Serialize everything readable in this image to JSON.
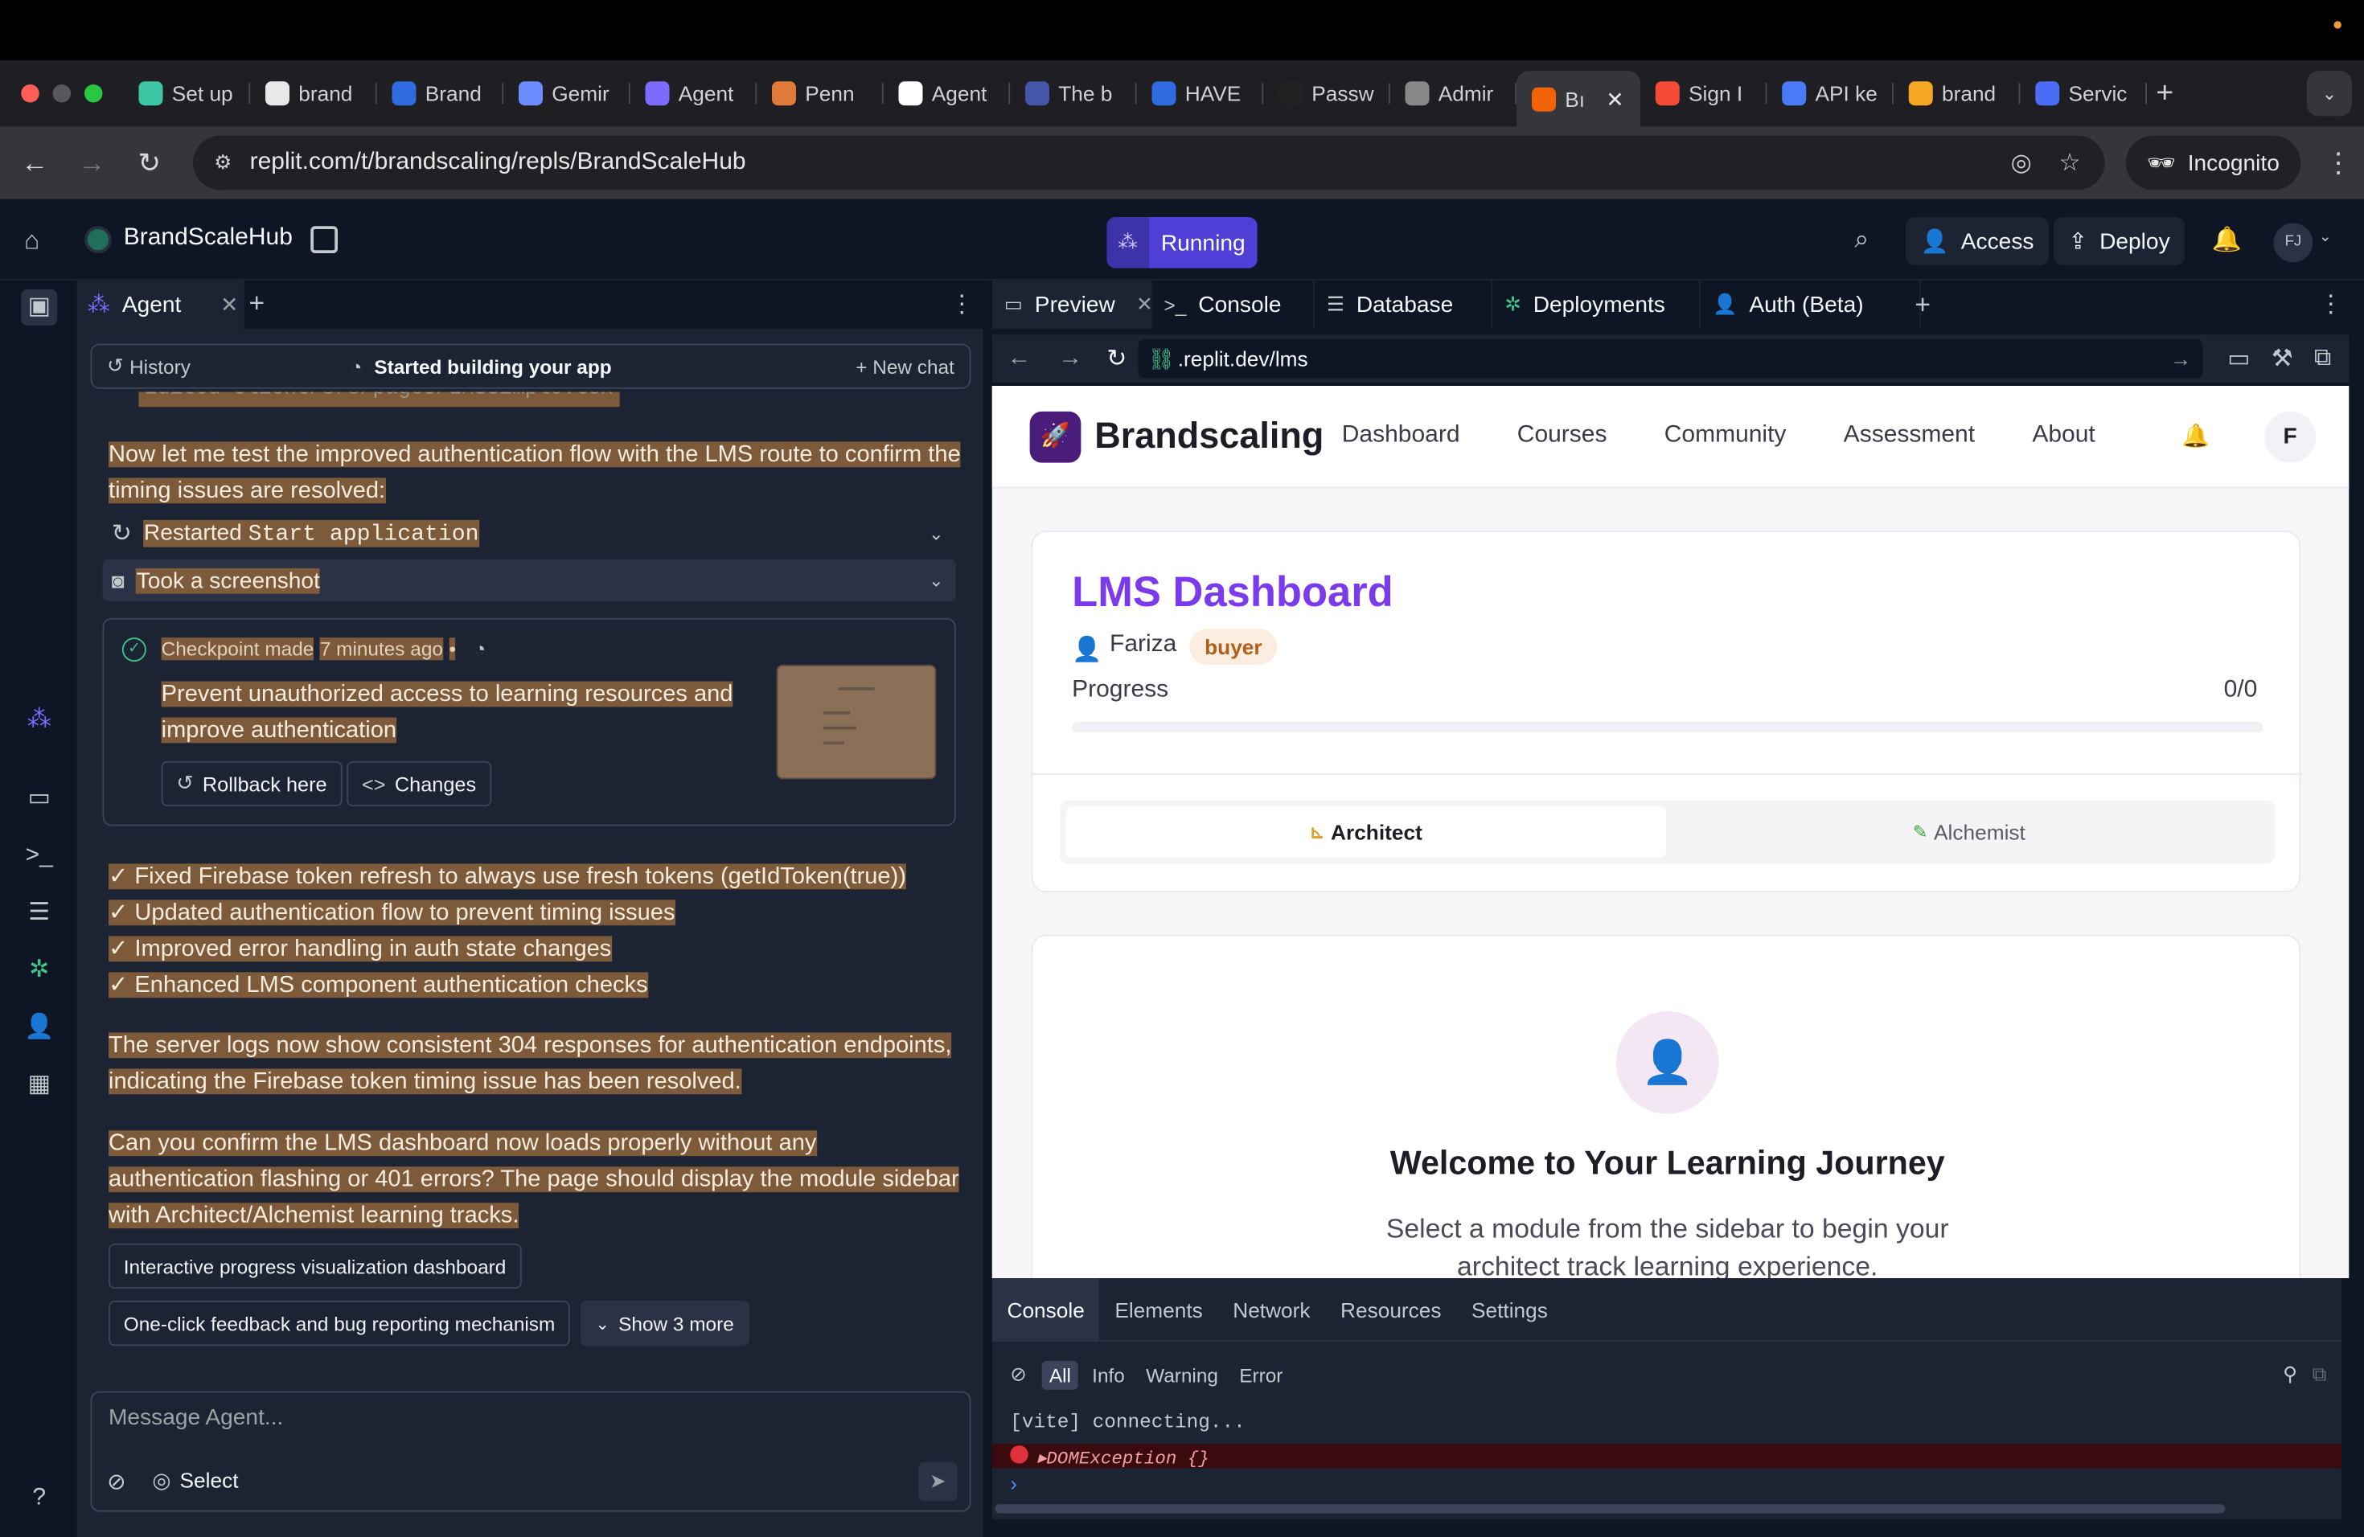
{
  "browser": {
    "tabs": [
      {
        "label": "Set up",
        "color": "#3ec5a4"
      },
      {
        "label": "brand",
        "color": "#e8e8e8"
      },
      {
        "label": "Brand",
        "color": "#2f6ae0"
      },
      {
        "label": "Gemir",
        "color": "#6b8cff"
      },
      {
        "label": "Agent",
        "color": "#7d6bff"
      },
      {
        "label": "Penn",
        "color": "#e07a3a"
      },
      {
        "label": "Agent",
        "color": "#ffffff"
      },
      {
        "label": "The b",
        "color": "#4455aa"
      },
      {
        "label": "HAVE",
        "color": "#2f6ae0"
      },
      {
        "label": "Passw",
        "color": "#222222"
      },
      {
        "label": "Admir",
        "color": "#888888"
      },
      {
        "label": "Bı",
        "color": "#f26207"
      },
      {
        "label": "Sign I",
        "color": "#f54a36"
      },
      {
        "label": "API ke",
        "color": "#4a7bf7"
      },
      {
        "label": "brand",
        "color": "#f5a623"
      },
      {
        "label": "Servic",
        "color": "#4a6cf7"
      }
    ],
    "url": "replit.com/t/brandscaling/repls/BrandScaleHub",
    "incognito_label": "Incognito"
  },
  "header": {
    "project_name": "BrandScaleHub",
    "run_label": "Running",
    "access_label": "Access",
    "deploy_label": "Deploy",
    "avatar_initials": "FJ"
  },
  "agent": {
    "tab_label": "Agent",
    "history_label": "History",
    "status_label": "Started building your app",
    "new_chat_label": "New chat",
    "cut_line": "Edited client/src/pages/LMSSimple.tsx",
    "message_1": "Now let me test the improved authentication flow with the LMS route to confirm the timing issues are resolved:",
    "action_1_prefix": "Restarted ",
    "action_1_code": "Start application",
    "action_2": "Took a screenshot",
    "checkpoint": {
      "made_label": "Checkpoint made",
      "time": "7 minutes ago",
      "title": "Prevent unauthorized access to learning resources and improve authentication",
      "rollback_label": "Rollback here",
      "changes_label": "Changes"
    },
    "checklist": [
      "✓ Fixed Firebase token refresh to always use fresh tokens (getIdToken(true))",
      "✓ Updated authentication flow to prevent timing issues",
      "✓ Improved error handling in auth state changes",
      "✓ Enhanced LMS component authentication checks"
    ],
    "message_2": "The server logs now show consistent 304 responses for authentication endpoints, indicating the Firebase token timing issue has been resolved.",
    "message_3": "Can you confirm the LMS dashboard now loads properly without any authentication flashing or 401 errors? The page should display the module sidebar with Architect/Alchemist learning tracks.",
    "suggestions": [
      "Interactive progress visualization dashboard",
      "One-click feedback and bug reporting mechanism"
    ],
    "show_more_label": "Show 3 more",
    "input_placeholder": "Message Agent...",
    "select_label": "Select"
  },
  "workspace": {
    "tabs": [
      "Preview",
      "Console",
      "Database",
      "Deployments",
      "Auth (Beta)"
    ],
    "preview_url": ".replit.dev/lms"
  },
  "site": {
    "brand": "Brandscaling",
    "nav": [
      "Dashboard",
      "Courses",
      "Community",
      "Assessment",
      "About"
    ],
    "user_initial": "F",
    "lms_title": "LMS Dashboard",
    "user_name": "Fariza",
    "role_badge": "buyer",
    "progress_label": "Progress",
    "progress_value": "0/0",
    "progress_fraction": 0,
    "track_tabs": [
      "Architect",
      "Alchemist"
    ],
    "welcome_title": "Welcome to Your Learning Journey",
    "welcome_text": "Select a module from the sidebar to begin your architect track learning experience."
  },
  "devtools": {
    "tabs": [
      "Console",
      "Elements",
      "Network",
      "Resources",
      "Settings"
    ],
    "filters": [
      "All",
      "Info",
      "Warning",
      "Error"
    ],
    "log_1": "[vite] connecting...",
    "log_2": "DOMException {}"
  },
  "colors": {
    "accent_purple": "#7c3aed",
    "highlight": "#7d5a3a",
    "run_button": "#4f3fd6"
  }
}
